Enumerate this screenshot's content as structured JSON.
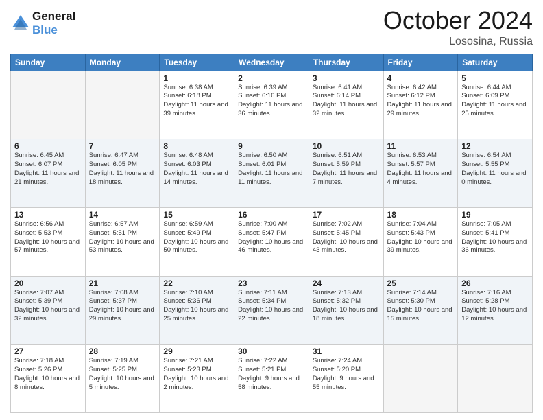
{
  "header": {
    "logo_line1": "General",
    "logo_line2": "Blue",
    "month": "October 2024",
    "location": "Lososina, Russia"
  },
  "weekdays": [
    "Sunday",
    "Monday",
    "Tuesday",
    "Wednesday",
    "Thursday",
    "Friday",
    "Saturday"
  ],
  "weeks": [
    [
      {
        "day": "",
        "sunrise": "",
        "sunset": "",
        "daylight": "",
        "empty": true
      },
      {
        "day": "",
        "sunrise": "",
        "sunset": "",
        "daylight": "",
        "empty": true
      },
      {
        "day": "1",
        "sunrise": "Sunrise: 6:38 AM",
        "sunset": "Sunset: 6:18 PM",
        "daylight": "Daylight: 11 hours and 39 minutes.",
        "empty": false
      },
      {
        "day": "2",
        "sunrise": "Sunrise: 6:39 AM",
        "sunset": "Sunset: 6:16 PM",
        "daylight": "Daylight: 11 hours and 36 minutes.",
        "empty": false
      },
      {
        "day": "3",
        "sunrise": "Sunrise: 6:41 AM",
        "sunset": "Sunset: 6:14 PM",
        "daylight": "Daylight: 11 hours and 32 minutes.",
        "empty": false
      },
      {
        "day": "4",
        "sunrise": "Sunrise: 6:42 AM",
        "sunset": "Sunset: 6:12 PM",
        "daylight": "Daylight: 11 hours and 29 minutes.",
        "empty": false
      },
      {
        "day": "5",
        "sunrise": "Sunrise: 6:44 AM",
        "sunset": "Sunset: 6:09 PM",
        "daylight": "Daylight: 11 hours and 25 minutes.",
        "empty": false
      }
    ],
    [
      {
        "day": "6",
        "sunrise": "Sunrise: 6:45 AM",
        "sunset": "Sunset: 6:07 PM",
        "daylight": "Daylight: 11 hours and 21 minutes.",
        "empty": false
      },
      {
        "day": "7",
        "sunrise": "Sunrise: 6:47 AM",
        "sunset": "Sunset: 6:05 PM",
        "daylight": "Daylight: 11 hours and 18 minutes.",
        "empty": false
      },
      {
        "day": "8",
        "sunrise": "Sunrise: 6:48 AM",
        "sunset": "Sunset: 6:03 PM",
        "daylight": "Daylight: 11 hours and 14 minutes.",
        "empty": false
      },
      {
        "day": "9",
        "sunrise": "Sunrise: 6:50 AM",
        "sunset": "Sunset: 6:01 PM",
        "daylight": "Daylight: 11 hours and 11 minutes.",
        "empty": false
      },
      {
        "day": "10",
        "sunrise": "Sunrise: 6:51 AM",
        "sunset": "Sunset: 5:59 PM",
        "daylight": "Daylight: 11 hours and 7 minutes.",
        "empty": false
      },
      {
        "day": "11",
        "sunrise": "Sunrise: 6:53 AM",
        "sunset": "Sunset: 5:57 PM",
        "daylight": "Daylight: 11 hours and 4 minutes.",
        "empty": false
      },
      {
        "day": "12",
        "sunrise": "Sunrise: 6:54 AM",
        "sunset": "Sunset: 5:55 PM",
        "daylight": "Daylight: 11 hours and 0 minutes.",
        "empty": false
      }
    ],
    [
      {
        "day": "13",
        "sunrise": "Sunrise: 6:56 AM",
        "sunset": "Sunset: 5:53 PM",
        "daylight": "Daylight: 10 hours and 57 minutes.",
        "empty": false
      },
      {
        "day": "14",
        "sunrise": "Sunrise: 6:57 AM",
        "sunset": "Sunset: 5:51 PM",
        "daylight": "Daylight: 10 hours and 53 minutes.",
        "empty": false
      },
      {
        "day": "15",
        "sunrise": "Sunrise: 6:59 AM",
        "sunset": "Sunset: 5:49 PM",
        "daylight": "Daylight: 10 hours and 50 minutes.",
        "empty": false
      },
      {
        "day": "16",
        "sunrise": "Sunrise: 7:00 AM",
        "sunset": "Sunset: 5:47 PM",
        "daylight": "Daylight: 10 hours and 46 minutes.",
        "empty": false
      },
      {
        "day": "17",
        "sunrise": "Sunrise: 7:02 AM",
        "sunset": "Sunset: 5:45 PM",
        "daylight": "Daylight: 10 hours and 43 minutes.",
        "empty": false
      },
      {
        "day": "18",
        "sunrise": "Sunrise: 7:04 AM",
        "sunset": "Sunset: 5:43 PM",
        "daylight": "Daylight: 10 hours and 39 minutes.",
        "empty": false
      },
      {
        "day": "19",
        "sunrise": "Sunrise: 7:05 AM",
        "sunset": "Sunset: 5:41 PM",
        "daylight": "Daylight: 10 hours and 36 minutes.",
        "empty": false
      }
    ],
    [
      {
        "day": "20",
        "sunrise": "Sunrise: 7:07 AM",
        "sunset": "Sunset: 5:39 PM",
        "daylight": "Daylight: 10 hours and 32 minutes.",
        "empty": false
      },
      {
        "day": "21",
        "sunrise": "Sunrise: 7:08 AM",
        "sunset": "Sunset: 5:37 PM",
        "daylight": "Daylight: 10 hours and 29 minutes.",
        "empty": false
      },
      {
        "day": "22",
        "sunrise": "Sunrise: 7:10 AM",
        "sunset": "Sunset: 5:36 PM",
        "daylight": "Daylight: 10 hours and 25 minutes.",
        "empty": false
      },
      {
        "day": "23",
        "sunrise": "Sunrise: 7:11 AM",
        "sunset": "Sunset: 5:34 PM",
        "daylight": "Daylight: 10 hours and 22 minutes.",
        "empty": false
      },
      {
        "day": "24",
        "sunrise": "Sunrise: 7:13 AM",
        "sunset": "Sunset: 5:32 PM",
        "daylight": "Daylight: 10 hours and 18 minutes.",
        "empty": false
      },
      {
        "day": "25",
        "sunrise": "Sunrise: 7:14 AM",
        "sunset": "Sunset: 5:30 PM",
        "daylight": "Daylight: 10 hours and 15 minutes.",
        "empty": false
      },
      {
        "day": "26",
        "sunrise": "Sunrise: 7:16 AM",
        "sunset": "Sunset: 5:28 PM",
        "daylight": "Daylight: 10 hours and 12 minutes.",
        "empty": false
      }
    ],
    [
      {
        "day": "27",
        "sunrise": "Sunrise: 7:18 AM",
        "sunset": "Sunset: 5:26 PM",
        "daylight": "Daylight: 10 hours and 8 minutes.",
        "empty": false
      },
      {
        "day": "28",
        "sunrise": "Sunrise: 7:19 AM",
        "sunset": "Sunset: 5:25 PM",
        "daylight": "Daylight: 10 hours and 5 minutes.",
        "empty": false
      },
      {
        "day": "29",
        "sunrise": "Sunrise: 7:21 AM",
        "sunset": "Sunset: 5:23 PM",
        "daylight": "Daylight: 10 hours and 2 minutes.",
        "empty": false
      },
      {
        "day": "30",
        "sunrise": "Sunrise: 7:22 AM",
        "sunset": "Sunset: 5:21 PM",
        "daylight": "Daylight: 9 hours and 58 minutes.",
        "empty": false
      },
      {
        "day": "31",
        "sunrise": "Sunrise: 7:24 AM",
        "sunset": "Sunset: 5:20 PM",
        "daylight": "Daylight: 9 hours and 55 minutes.",
        "empty": false
      },
      {
        "day": "",
        "sunrise": "",
        "sunset": "",
        "daylight": "",
        "empty": true
      },
      {
        "day": "",
        "sunrise": "",
        "sunset": "",
        "daylight": "",
        "empty": true
      }
    ]
  ]
}
